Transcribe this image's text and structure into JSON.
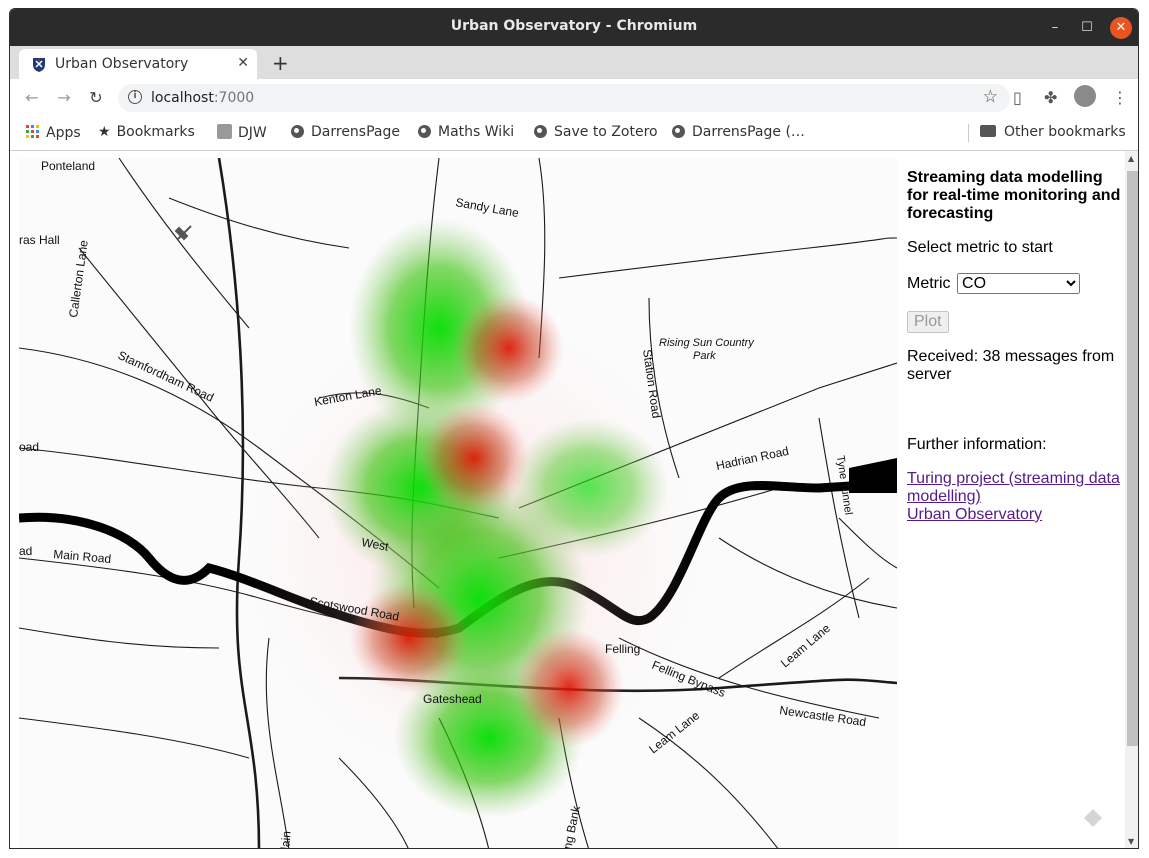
{
  "window": {
    "title": "Urban Observatory - Chromium"
  },
  "tab": {
    "title": "Urban Observatory",
    "close": "✕"
  },
  "omnibox": {
    "host": "localhost",
    "port": ":7000"
  },
  "bookmarks": {
    "items": [
      "Apps",
      "Bookmarks",
      "DJW",
      "DarrensPage",
      "Maths Wiki",
      "Save to Zotero",
      "DarrensPage (…"
    ],
    "other": "Other bookmarks"
  },
  "sidebar": {
    "heading": "Streaming data modelling for real-time monitoring and forecasting",
    "prompt": "Select metric to start",
    "metric_label": "Metric",
    "metric_selected": "CO",
    "plot_label": "Plot",
    "status": "Received: 38 messages from server",
    "further": "Further information:",
    "link1": "Turing project (streaming data modelling)",
    "link2": "Urban Observatory"
  },
  "map": {
    "labels": [
      "Ponteland",
      "ras Hall",
      "Callerton Lane",
      "Stamfordham Road",
      "Kenton Lane",
      "oad",
      "ad",
      "Main Road",
      "Sandy Lane",
      "Rising Sun Country",
      "Park",
      "Station Road",
      "Hadrian Road",
      "Tyne Tunnel",
      "Scotswood Road",
      "West",
      "Felling",
      "Felling Bypass",
      "Leam Lane",
      "Newcastle Road",
      "Gateshead",
      "Leam Lane",
      "ng Bank",
      "lain"
    ]
  }
}
